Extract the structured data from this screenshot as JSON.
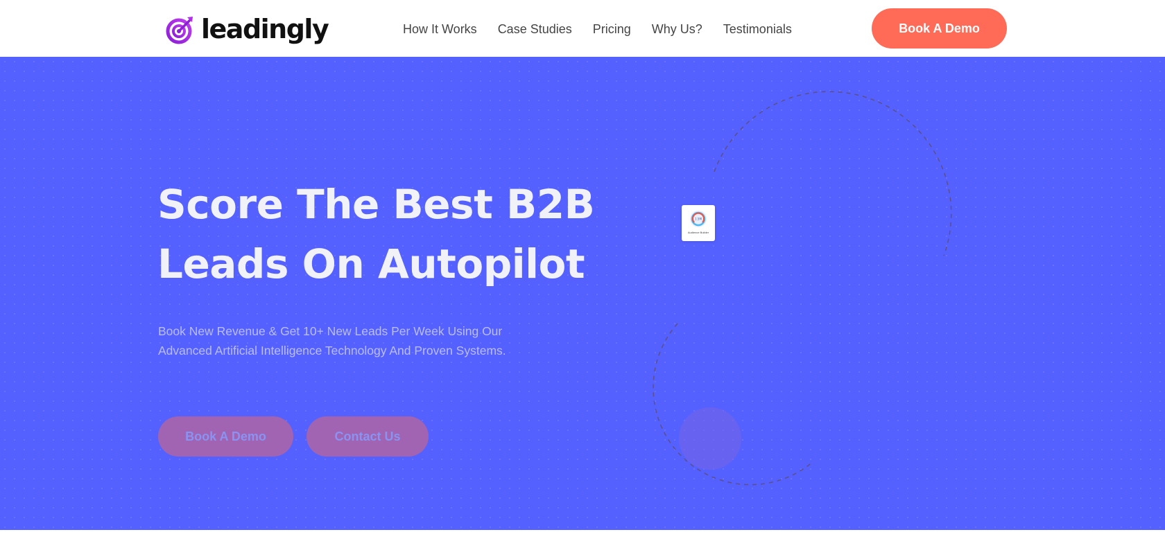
{
  "brand": {
    "name": "leadingly",
    "logo_icon": "target-arrow-icon",
    "logo_color": "#9B2BE0"
  },
  "nav": {
    "links": [
      {
        "label": "How It Works"
      },
      {
        "label": "Case Studies"
      },
      {
        "label": "Pricing"
      },
      {
        "label": "Why Us?"
      },
      {
        "label": "Testimonials"
      }
    ],
    "cta_label": "Book A Demo"
  },
  "hero": {
    "headline_line1": "Score The Best B2B",
    "headline_line2": "Leads On Autopilot",
    "subtitle_line1": "Book New Revenue & Get 10+ New Leads Per Week Using Our",
    "subtitle_line2": "Advanced Artificial Intelligence Technology And Proven Systems.",
    "primary_button": "Book A Demo",
    "secondary_button": "Contact Us",
    "card": {
      "label": "Audience Builder",
      "gauge_value": "1.5M",
      "icon": "gauge-icon"
    }
  },
  "colors": {
    "hero_bg": "#5561FF",
    "cta": "#FF6B57",
    "hero_button": "#A064B2",
    "headline": "#F1F1F8"
  }
}
